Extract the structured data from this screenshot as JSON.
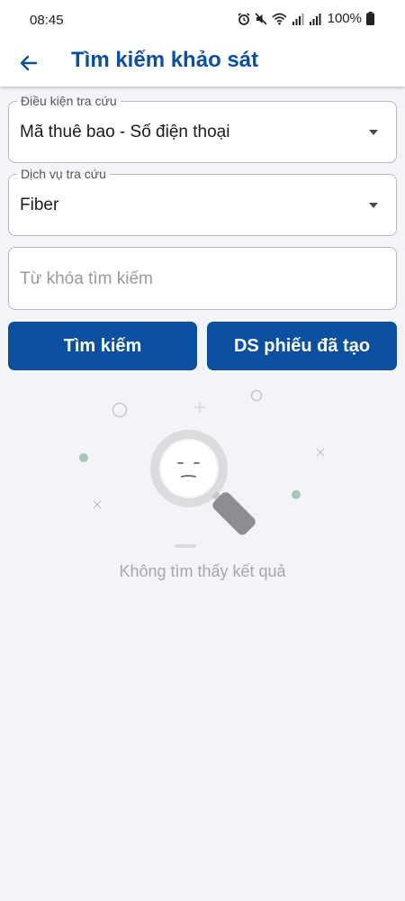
{
  "status_bar": {
    "time": "08:45",
    "battery": "100%",
    "icons": [
      "alarm-icon",
      "mute-icon",
      "wifi-icon",
      "signal-icon",
      "signal-icon",
      "battery-icon"
    ]
  },
  "app_bar": {
    "title": "Tìm kiếm khảo sát",
    "back_icon": "arrow-left-icon"
  },
  "form": {
    "condition": {
      "label": "Điều kiện tra cứu",
      "value": "Mã thuê bao - Số điện thoại"
    },
    "service": {
      "label": "Dịch vụ tra cứu",
      "value": "Fiber"
    },
    "keyword": {
      "placeholder": "Từ khóa tìm kiếm"
    }
  },
  "buttons": {
    "search": "Tìm kiếm",
    "created_list": "DS phiếu đã tạo"
  },
  "empty_state": {
    "message": "Không tìm thấy kết quả",
    "icon": "magnifier-icon"
  },
  "colors": {
    "primary": "#0a4fa0",
    "background": "#f4f3f7"
  }
}
